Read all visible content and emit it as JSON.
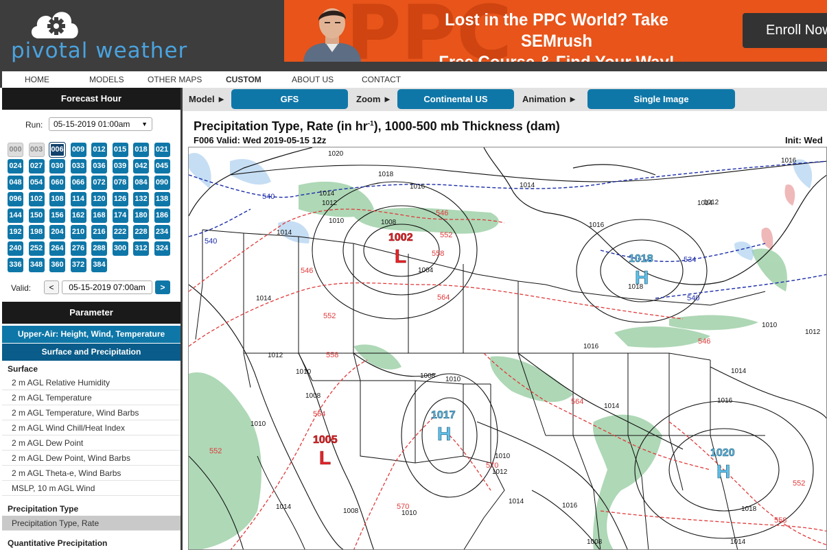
{
  "header": {
    "logo_text": "pivotal weather",
    "ad": {
      "bg_text": "PPC",
      "headline_line1": "Lost in the PPC World? Take SEMrush",
      "headline_line2": "Free Course & Find Your Way!",
      "cta": "Enroll Now",
      "color": "#e8541a"
    }
  },
  "nav": {
    "items": [
      "HOME",
      "MODELS",
      "OTHER MAPS",
      "CUSTOM",
      "ABOUT US",
      "CONTACT"
    ],
    "active": "CUSTOM"
  },
  "forecast_hour": {
    "title": "Forecast Hour",
    "run_label": "Run:",
    "run_value": "05-15-2019 01:00am",
    "hours": [
      "000",
      "003",
      "006",
      "009",
      "012",
      "015",
      "018",
      "021",
      "024",
      "027",
      "030",
      "033",
      "036",
      "039",
      "042",
      "045",
      "048",
      "054",
      "060",
      "066",
      "072",
      "078",
      "084",
      "090",
      "096",
      "102",
      "108",
      "114",
      "120",
      "126",
      "132",
      "138",
      "144",
      "150",
      "156",
      "162",
      "168",
      "174",
      "180",
      "186",
      "192",
      "198",
      "204",
      "210",
      "216",
      "222",
      "228",
      "234",
      "240",
      "252",
      "264",
      "276",
      "288",
      "300",
      "312",
      "324",
      "336",
      "348",
      "360",
      "372",
      "384"
    ],
    "disabled_hours": [
      "000",
      "003"
    ],
    "selected_hour": "006",
    "valid_label": "Valid:",
    "valid_value": "05-15-2019 07:00am",
    "prev_label": "<",
    "next_label": ">"
  },
  "parameter": {
    "title": "Parameter",
    "categories": [
      "Upper-Air: Height, Wind, Temperature",
      "Surface and Precipitation"
    ],
    "surface_header": "Surface",
    "surface_items": [
      "2 m AGL Relative Humidity",
      "2 m AGL Temperature",
      "2 m AGL Temperature, Wind Barbs",
      "2 m AGL Wind Chill/Heat Index",
      "2 m AGL Dew Point",
      "2 m AGL Dew Point, Wind Barbs",
      "2 m AGL Theta-e, Wind Barbs",
      "MSLP, 10 m AGL Wind"
    ],
    "precip_header": "Precipitation Type",
    "precip_items": [
      "Precipitation Type, Rate"
    ],
    "active_item": "Precipitation Type, Rate",
    "qpf_header": "Quantitative Precipitation"
  },
  "toolbar": {
    "model_label": "Model ►",
    "model_value": "GFS",
    "zoom_label": "Zoom ►",
    "zoom_value": "Continental US",
    "anim_label": "Animation ►",
    "anim_value": "Single Image"
  },
  "map": {
    "title": "Precipitation Type, Rate (in hr",
    "title_sup": "-1",
    "title_rest": "), 1000-500 mb Thickness (dam)",
    "subtitle": "F006 Valid: Wed 2019-05-15 12z",
    "init": "Init: Wed",
    "centers": [
      {
        "type": "L",
        "value": "1002"
      },
      {
        "type": "H",
        "value": "1018"
      },
      {
        "type": "H",
        "value": "1017"
      },
      {
        "type": "L",
        "value": "1005"
      },
      {
        "type": "H",
        "value": "1020"
      }
    ],
    "isobar_labels": [
      "1020",
      "1018",
      "1016",
      "1014",
      "1014",
      "1012",
      "1010",
      "1008",
      "1004",
      "1014",
      "1016",
      "1014",
      "1018",
      "1014",
      "1012",
      "1010",
      "1008",
      "1010",
      "1016",
      "1014",
      "1012",
      "1010",
      "1008",
      "1010",
      "1014",
      "1008",
      "1010",
      "1012",
      "1014",
      "1016",
      "1018",
      "1016",
      "1010",
      "1014",
      "1012",
      "1016",
      "1014",
      "1008"
    ],
    "thickness_labels": [
      "540",
      "540",
      "546",
      "552",
      "558",
      "546",
      "564",
      "552",
      "558",
      "534",
      "540",
      "546",
      "564",
      "570",
      "570",
      "552",
      "564",
      "558",
      "552"
    ],
    "colors": {
      "low": "#e8262b",
      "high": "#5ec1ea",
      "thickness_cold": "#1a2ba8",
      "thickness_warm": "#e0393a",
      "isobar": "#111111",
      "rain": "#4fa861",
      "snow": "#7fb2e0"
    }
  }
}
